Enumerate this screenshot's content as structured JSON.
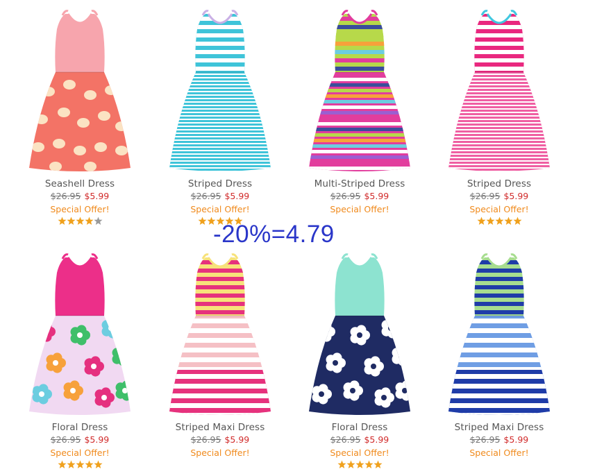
{
  "annotation": "-20%=4.79",
  "products": [
    {
      "name": "Seashell Dress",
      "old_price": "$26.95",
      "new_price": "$5.99",
      "offer": "Special Offer!",
      "rating": 4,
      "colors": {
        "top": "#f7a5ad",
        "skirt": "#f37366",
        "skirt2": "#fbe3c3",
        "strap": "#f7a5ad"
      },
      "skirt_pattern": "shells"
    },
    {
      "name": "Striped Dress",
      "old_price": "$26.95",
      "new_price": "$5.99",
      "offer": "Special Offer!",
      "rating": 5,
      "colors": {
        "top": "#3fc4d9",
        "skirt": "#3fc4d9",
        "skirt2": "#ffffff",
        "strap": "#c9b0e6"
      },
      "skirt_pattern": "thin-stripes"
    },
    {
      "name": "Multi-Striped Dress",
      "old_price": "$26.95",
      "new_price": "$5.99",
      "offer": "Special Offer!",
      "rating": 0,
      "colors": {
        "top": "#b7d94a",
        "skirt": "#e23d9d",
        "skirt2": "#3a4d9b",
        "strap": "#e23d9d"
      },
      "skirt_pattern": "multi-stripes"
    },
    {
      "name": "Striped Dress",
      "old_price": "$26.95",
      "new_price": "$5.99",
      "offer": "Special Offer!",
      "rating": 5,
      "colors": {
        "top": "#e9287f",
        "skirt": "#ef5fa2",
        "skirt2": "#ffffff",
        "strap": "#41c7e0"
      },
      "skirt_pattern": "thin-stripes"
    },
    {
      "name": "Floral Dress",
      "old_price": "$26.95",
      "new_price": "$5.99",
      "offer": "Special Offer!",
      "rating": 5,
      "colors": {
        "top": "#ec2f89",
        "skirt": "#f1d9f2",
        "skirt2": "#e5307f",
        "strap": "#ec2f89"
      },
      "skirt_pattern": "floral"
    },
    {
      "name": "Striped Maxi Dress",
      "old_price": "$26.95",
      "new_price": "$5.99",
      "offer": "Special Offer!",
      "rating": 0,
      "colors": {
        "top": "#f7e27a",
        "skirt": "#f5c0c5",
        "skirt2": "#e6327d",
        "strap": "#f7e27a"
      },
      "skirt_pattern": "maxi"
    },
    {
      "name": "Floral Dress",
      "old_price": "$26.95",
      "new_price": "$5.99",
      "offer": "Special Offer!",
      "rating": 5,
      "colors": {
        "top": "#8de3d0",
        "skirt": "#1f2b63",
        "skirt2": "#ffffff",
        "strap": "#8de3d0"
      },
      "skirt_pattern": "floral-dark"
    },
    {
      "name": "Striped Maxi Dress",
      "old_price": "$26.95",
      "new_price": "$5.99",
      "offer": "Special Offer!",
      "rating": 0,
      "colors": {
        "top": "#a7dd8f",
        "skirt": "#6f9ee4",
        "skirt2": "#1f3ca8",
        "strap": "#a7dd8f"
      },
      "skirt_pattern": "maxi"
    }
  ]
}
